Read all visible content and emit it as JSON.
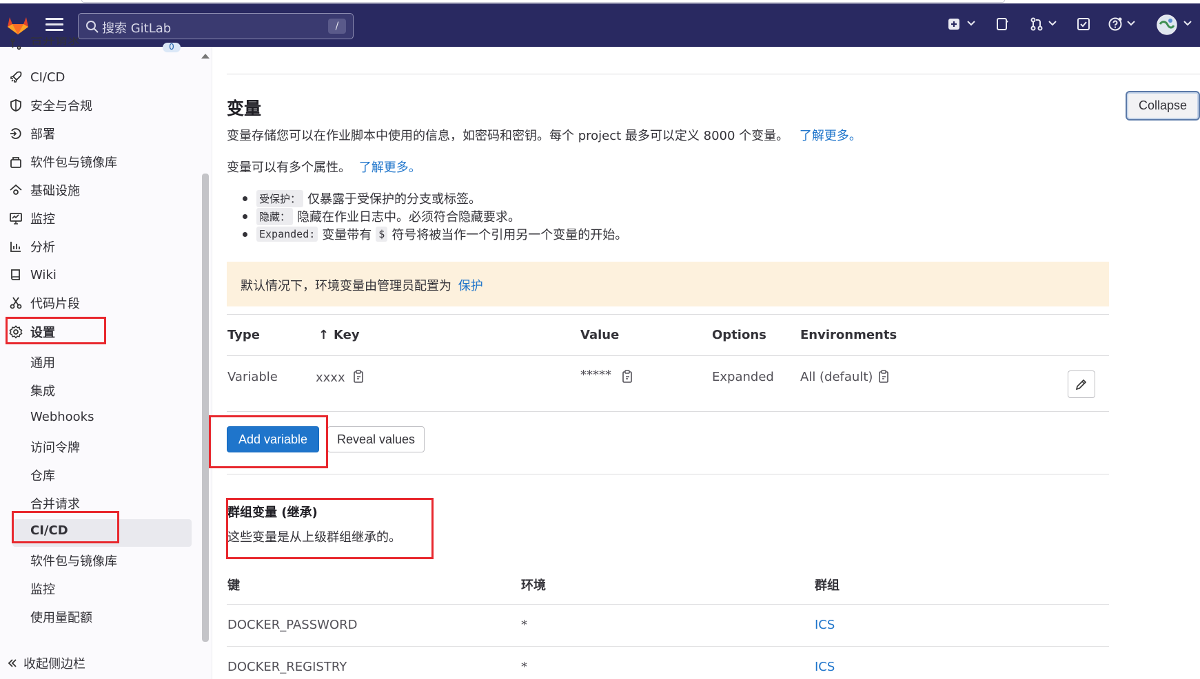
{
  "topbar": {
    "search_placeholder": "搜索 GitLab",
    "search_shortcut": "/"
  },
  "sidebar": {
    "partial_top_label": "合并请求",
    "partial_top_badge": "0",
    "items": [
      {
        "label": "CI/CD",
        "icon": "rocket-icon"
      },
      {
        "label": "安全与合规",
        "icon": "shield-icon"
      },
      {
        "label": "部署",
        "icon": "deploy-icon"
      },
      {
        "label": "软件包与镜像库",
        "icon": "package-icon"
      },
      {
        "label": "基础设施",
        "icon": "cloud-gear-icon"
      },
      {
        "label": "监控",
        "icon": "monitor-icon"
      },
      {
        "label": "分析",
        "icon": "chart-icon"
      },
      {
        "label": "Wiki",
        "icon": "book-icon"
      },
      {
        "label": "代码片段",
        "icon": "scissors-icon"
      },
      {
        "label": "设置",
        "icon": "gear-icon"
      }
    ],
    "settings_sub": [
      "通用",
      "集成",
      "Webhooks",
      "访问令牌",
      "仓库",
      "合并请求",
      "CI/CD",
      "软件包与镜像库",
      "监控",
      "使用量配额"
    ],
    "collapse_label": "收起侧边栏"
  },
  "main": {
    "title": "变量",
    "description": "变量存储您可以在作业脚本中使用的信息，如密码和密钥。每个 project 最多可以定义 8000 个变量。",
    "learn_more": "了解更多。",
    "attributes_text": "变量可以有多个属性。",
    "attributes_link": "了解更多。",
    "bullets": [
      {
        "code": "受保护：",
        "text": "仅暴露于受保护的分支或标签。"
      },
      {
        "code": "隐藏：",
        "text": "隐藏在作业日志中。必须符合隐藏要求。"
      },
      {
        "code": "Expanded:",
        "text_before": "变量带有",
        "code2": "$",
        "text_after": "符号将被当作一个引用另一个变量的开始。"
      }
    ],
    "alert_text": "默认情况下，环境变量由管理员配置为",
    "alert_link": "保护",
    "collapse_label": "Collapse",
    "table": {
      "headers": [
        "Type",
        "Key",
        "Value",
        "Options",
        "Environments"
      ],
      "sort_arrow": "↑",
      "row": {
        "type": "Variable",
        "key": "xxxx",
        "value": "*****",
        "options": "Expanded",
        "environments": "All (default)"
      }
    },
    "add_variable_label": "Add variable",
    "reveal_values_label": "Reveal values",
    "inherited": {
      "title": "群组变量 (继承)",
      "description": "这些变量是从上级群组继承的。",
      "headers": [
        "键",
        "环境",
        "群组"
      ],
      "rows": [
        {
          "key": "DOCKER_PASSWORD",
          "env": "*",
          "group": "ICS"
        },
        {
          "key": "DOCKER_REGISTRY",
          "env": "*",
          "group": "ICS"
        }
      ]
    }
  }
}
